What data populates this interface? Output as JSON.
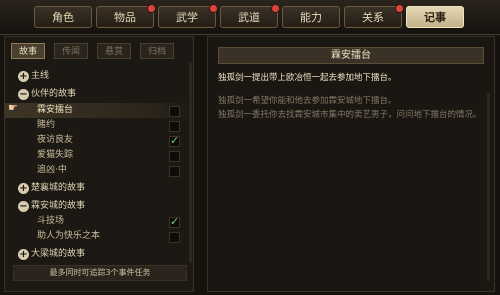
{
  "top_tabs": [
    {
      "label": "角色",
      "dot": false
    },
    {
      "label": "物品",
      "dot": true
    },
    {
      "label": "武学",
      "dot": true
    },
    {
      "label": "武道",
      "dot": true
    },
    {
      "label": "能力",
      "dot": false
    },
    {
      "label": "关系",
      "dot": true
    },
    {
      "label": "记事",
      "dot": false,
      "active": true
    }
  ],
  "sub_tabs": [
    {
      "label": "故事",
      "active": true
    },
    {
      "label": "传闻"
    },
    {
      "label": "悬赏"
    },
    {
      "label": "归档"
    }
  ],
  "story_list": [
    {
      "kind": "cat",
      "label": "主线",
      "expanded": false
    },
    {
      "kind": "cat",
      "label": "伙伴的故事",
      "expanded": true
    },
    {
      "kind": "sub",
      "label": "霖安擂台",
      "selected": true,
      "checked": false
    },
    {
      "kind": "sub",
      "label": "賭约",
      "checked": false
    },
    {
      "kind": "sub",
      "label": "夜访良友",
      "checked": true
    },
    {
      "kind": "sub",
      "label": "爱猫失踪",
      "checked": false
    },
    {
      "kind": "sub",
      "label": "追凶·中",
      "checked": false
    },
    {
      "kind": "cat",
      "label": "楚襄城的故事",
      "expanded": false
    },
    {
      "kind": "cat",
      "label": "霖安城的故事",
      "expanded": true
    },
    {
      "kind": "sub",
      "label": "斗技场",
      "checked": true
    },
    {
      "kind": "sub",
      "label": "助人为快乐之本",
      "checked": false
    },
    {
      "kind": "cat",
      "label": "大梁城的故事",
      "expanded": false
    }
  ],
  "footer_text": "最多同时可追踪3个事件任务",
  "detail": {
    "title": "霖安擂台",
    "line1": "独孤剑一提出带上欧冶恒一起去参加地下擂台。",
    "line2": "独孤剑一希望你能和他去参加霖安城地下擂台。",
    "line3": "独孤剑一委托你去找霖安城市集中的卖艺男子，问问地下擂台的情况。"
  },
  "icons": {
    "expand": "plus-icon",
    "collapse": "minus-icon",
    "pointer": "hand-pointer-icon",
    "checked": "checkmark-icon"
  },
  "colors": {
    "accent": "#e4d7b4",
    "check": "#6fd27a",
    "notify": "#d9463a"
  }
}
